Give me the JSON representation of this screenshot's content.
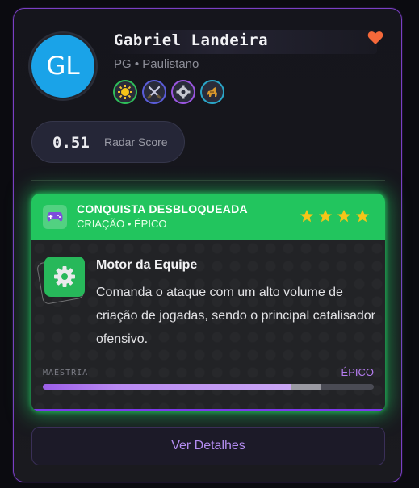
{
  "profile": {
    "initials": "GL",
    "name": "Gabriel Landeira",
    "position": "PG",
    "separator": "•",
    "team": "Paulistano",
    "avatar_color": "#1aa3e8",
    "favorite_icon": "heart-icon",
    "favorite_color": "#f4683a",
    "badges": [
      {
        "icon": "sun-badge-icon",
        "color": "#2fbf5a"
      },
      {
        "icon": "crossed-swords-badge-icon",
        "color": "#5a5cd8"
      },
      {
        "icon": "gear-badge-icon",
        "color": "#9a55e0"
      },
      {
        "icon": "cheetah-badge-icon",
        "color": "#2aa6c8"
      }
    ]
  },
  "score": {
    "value": "0.51",
    "label": "Radar Score"
  },
  "achievement": {
    "header_title": "CONQUISTA DESBLOQUEADA",
    "category": "CRIAÇÃO • ÉPICO",
    "header_icon": "gamepad-icon",
    "header_color": "#22c55e",
    "stars": 4,
    "star_color": "#f5c518",
    "icon": "gear-icon",
    "name": "Motor da Equipe",
    "description": "Comanda o ataque com um alto volume de criação de jogadas, sendo o principal catalisador ofensivo.",
    "mastery_label": "MAESTRIA",
    "mastery_level": "ÉPICO",
    "mastery_fraction": 0.75,
    "mastery_highlight_fraction": 0.09,
    "accent_color": "#7c3aed"
  },
  "actions": {
    "details_label": "Ver Detalhes"
  }
}
